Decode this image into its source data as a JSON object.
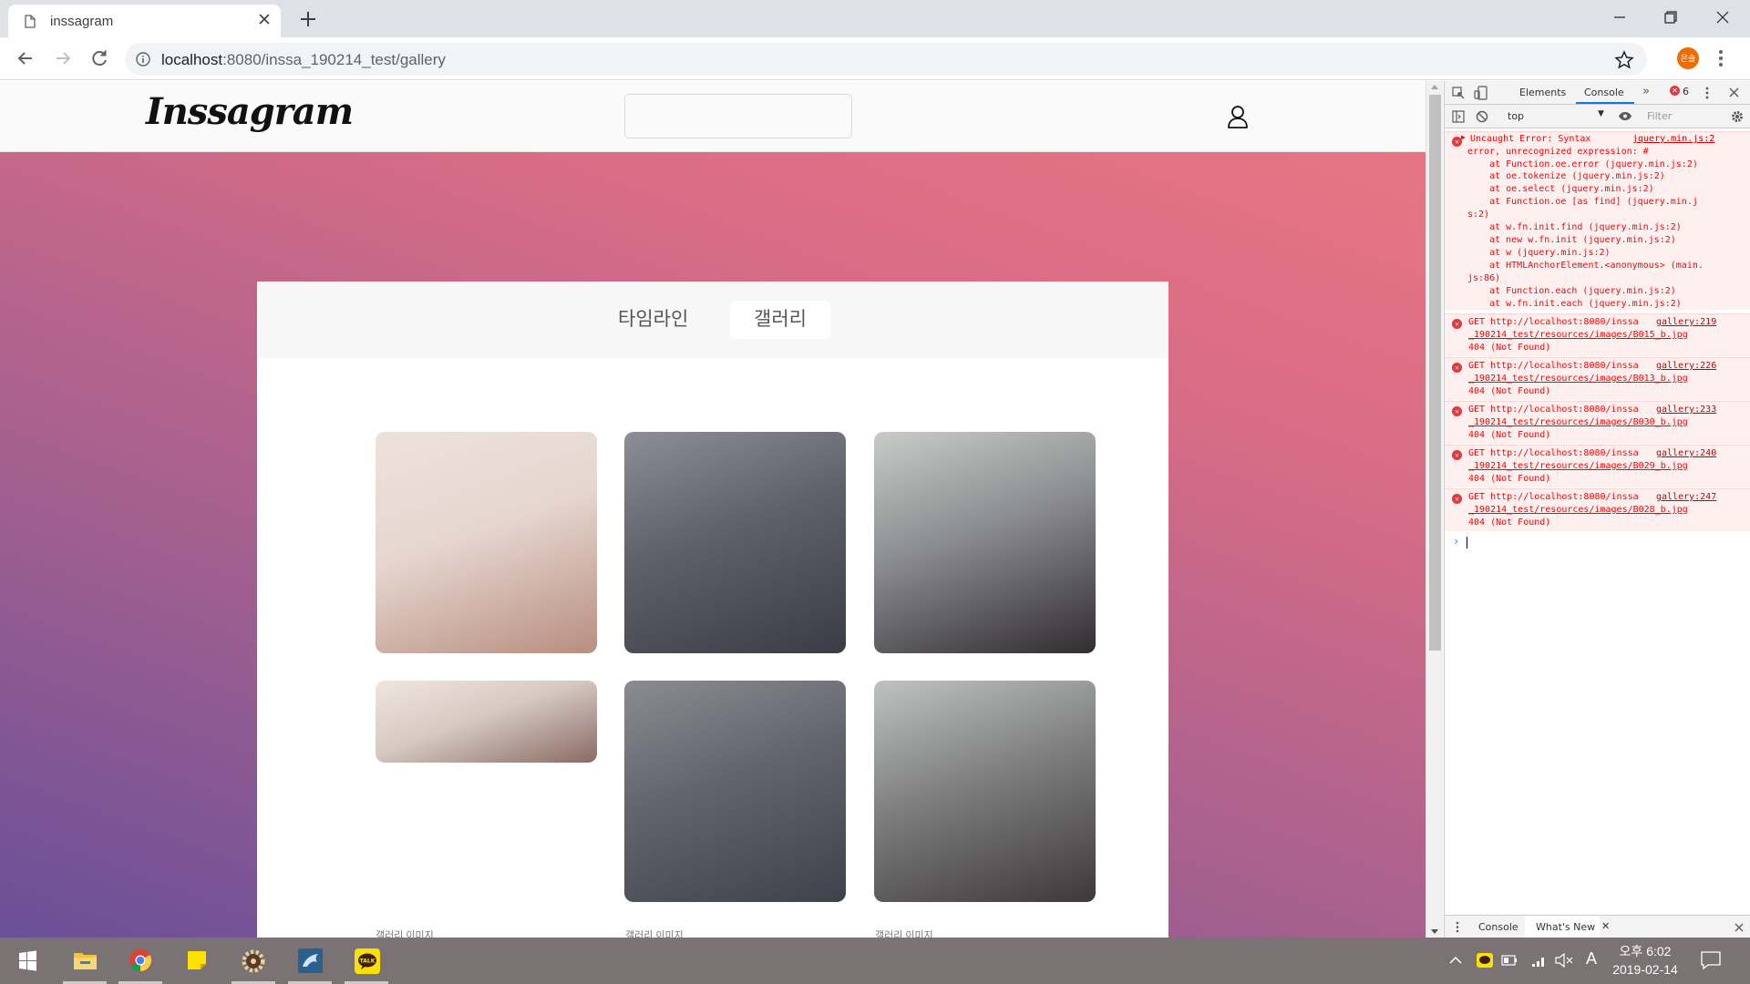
{
  "browser": {
    "tab_title": "inssagram",
    "url_host": "localhost",
    "url_rest": ":8080/inssa_190214_test/gallery",
    "profile_label": "은솔"
  },
  "site": {
    "logo": "Inssagram",
    "search_placeholder": "",
    "tabs": [
      {
        "label": "타임라인",
        "active": false
      },
      {
        "label": "갤러리",
        "active": true
      }
    ],
    "gallery": [
      {
        "alt": "",
        "gradient": [
          "#ece2dd",
          "#e6d6cf",
          "#b88e80"
        ]
      },
      {
        "alt": "",
        "gradient": [
          "#8d8f97",
          "#5e606a",
          "#3b3c45"
        ]
      },
      {
        "alt": "",
        "gradient": [
          "#c8ccc8",
          "#8b8c8f",
          "#312d30"
        ]
      },
      {
        "alt": "",
        "gradient": [
          "#efe6df",
          "#d6cbc3",
          "#8b6a64"
        ]
      },
      {
        "alt": "",
        "gradient": [
          "#8a8c93",
          "#62646d",
          "#40414a"
        ]
      },
      {
        "alt": "",
        "gradient": [
          "#bfc3c0",
          "#7f7f80",
          "#3d393b"
        ]
      }
    ],
    "broken_images": [
      "갤러리 이미지",
      "갤러리 이미지",
      "갤러리 이미지"
    ]
  },
  "devtools": {
    "tabs": [
      "Elements",
      "Console"
    ],
    "active_tab": "Console",
    "error_count": "6",
    "context": "top",
    "filter_placeholder": "Filter",
    "uncaught": {
      "lines": [
        "Uncaught Error: Syntax",
        "error, unrecognized expression: #",
        "    at Function.oe.error (jquery.min.js:2)",
        "    at oe.tokenize (jquery.min.js:2)",
        "    at oe.select (jquery.min.js:2)",
        "    at Function.oe [as find] (jquery.min.j",
        "s:2)",
        "    at w.fn.init.find (jquery.min.js:2)",
        "    at new w.fn.init (jquery.min.js:2)",
        "    at w (jquery.min.js:2)",
        "    at HTMLAnchorElement.<anonymous> (main.",
        "js:86)",
        "    at Function.each (jquery.min.js:2)",
        "    at w.fn.init.each (jquery.min.js:2)"
      ],
      "source": "jquery.min.js:2"
    },
    "get_errors": [
      {
        "l1": "GET http://localhost:8080/inssa",
        "l2": "_190214_test/resources/images/B015_b.jpg",
        "l3": "404 (Not Found)",
        "source": "gallery:219"
      },
      {
        "l1": "GET http://localhost:8080/inssa",
        "l2": "_190214_test/resources/images/B013_b.jpg",
        "l3": "404 (Not Found)",
        "source": "gallery:226"
      },
      {
        "l1": "GET http://localhost:8080/inssa",
        "l2": "_190214_test/resources/images/B030_b.jpg",
        "l3": "404 (Not Found)",
        "source": "gallery:233"
      },
      {
        "l1": "GET http://localhost:8080/inssa",
        "l2": "_190214_test/resources/images/B029_b.jpg",
        "l3": "404 (Not Found)",
        "source": "gallery:240"
      },
      {
        "l1": "GET http://localhost:8080/inssa",
        "l2": "_190214_test/resources/images/B028_b.jpg",
        "l3": "404 (Not Found)",
        "source": "gallery:247"
      }
    ],
    "drawer_tabs": [
      "Console",
      "What's New"
    ]
  },
  "taskbar": {
    "time": "오후 6:02",
    "date": "2019-02-14",
    "ime": "A"
  }
}
